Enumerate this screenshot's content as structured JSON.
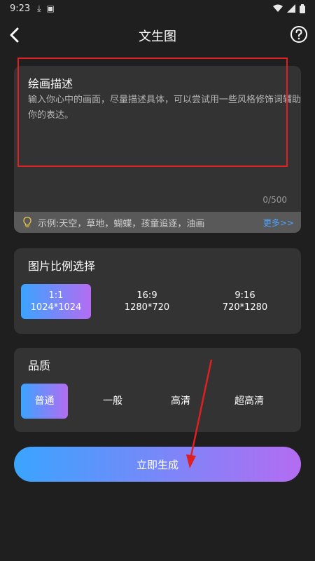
{
  "status_bar": {
    "time": "9:23"
  },
  "header": {
    "title": "文生图"
  },
  "description": {
    "title": "绘画描述",
    "placeholder": "输入你心中的画面，尽量描述具体，可以尝试用一些风格修饰词辅助你的表达。",
    "char_count": "0/500",
    "example_text": "示例:天空，草地，蝴蝶，孩童追逐，油画",
    "more_label": "更多>>"
  },
  "ratio": {
    "title": "图片比例选择",
    "options": [
      {
        "ratio": "1:1",
        "size": "1024*1024",
        "selected": true
      },
      {
        "ratio": "16:9",
        "size": "1280*720",
        "selected": false
      },
      {
        "ratio": "9:16",
        "size": "720*1280",
        "selected": false
      }
    ]
  },
  "quality": {
    "title": "品质",
    "options": [
      {
        "label": "普通",
        "selected": true
      },
      {
        "label": "一般",
        "selected": false
      },
      {
        "label": "高清",
        "selected": false
      },
      {
        "label": "超高清",
        "selected": false
      }
    ]
  },
  "generate_label": "立即生成",
  "colors": {
    "background": "#1f1f1f",
    "card": "#333333",
    "gradient_start": "#3aa4ff",
    "gradient_end": "#b46cf2",
    "annotation_red": "#e02020",
    "link_blue": "#4fa3ff"
  },
  "icons": [
    "download-icon",
    "notification-icon",
    "wifi-icon",
    "signal-icon",
    "battery-icon",
    "back-arrow-icon",
    "help-icon",
    "lightbulb-icon"
  ]
}
